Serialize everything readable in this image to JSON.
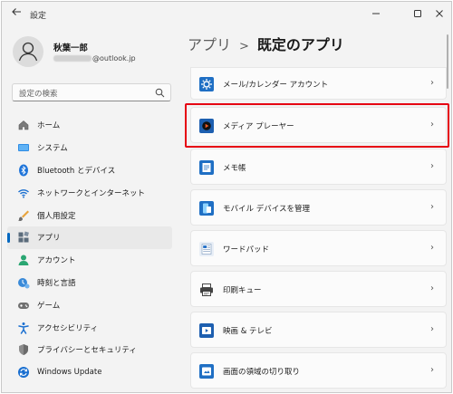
{
  "window": {
    "title": "設定",
    "controls": [
      "minimize-icon",
      "maximize-icon",
      "close-icon"
    ]
  },
  "profile": {
    "name": "秋葉一郎",
    "email_visible": "@outlook.jp"
  },
  "search": {
    "placeholder": "設定の検索"
  },
  "nav": {
    "items": [
      {
        "label": "ホーム",
        "icon": "home-icon"
      },
      {
        "label": "システム",
        "icon": "system-icon"
      },
      {
        "label": "Bluetooth とデバイス",
        "icon": "bluetooth-icon"
      },
      {
        "label": "ネットワークとインターネット",
        "icon": "network-icon"
      },
      {
        "label": "個人用設定",
        "icon": "personalization-icon"
      },
      {
        "label": "アプリ",
        "icon": "apps-icon",
        "active": true
      },
      {
        "label": "アカウント",
        "icon": "account-icon"
      },
      {
        "label": "時刻と言語",
        "icon": "time-language-icon"
      },
      {
        "label": "ゲーム",
        "icon": "gaming-icon"
      },
      {
        "label": "アクセシビリティ",
        "icon": "accessibility-icon"
      },
      {
        "label": "プライバシーとセキュリティ",
        "icon": "privacy-icon"
      },
      {
        "label": "Windows Update",
        "icon": "windows-update-icon"
      }
    ]
  },
  "header": {
    "breadcrumb_parent": "アプリ",
    "separator": ">",
    "current": "既定のアプリ"
  },
  "apps": {
    "items": [
      {
        "label": "メール/カレンダー アカウント",
        "icon": "mail-calendar-icon"
      },
      {
        "label": "メディア プレーヤー",
        "icon": "media-player-icon"
      },
      {
        "label": "メモ帳",
        "icon": "notepad-icon"
      },
      {
        "label": "モバイル デバイスを管理",
        "icon": "mobile-devices-icon"
      },
      {
        "label": "ワードパッド",
        "icon": "wordpad-icon"
      },
      {
        "label": "印刷キュー",
        "icon": "print-queue-icon"
      },
      {
        "label": "映画 & テレビ",
        "icon": "movies-tv-icon"
      },
      {
        "label": "画面の領域の切り取り",
        "icon": "snipping-icon"
      }
    ]
  },
  "colors": {
    "accent": "#0067c0",
    "highlight": "#e60012"
  }
}
